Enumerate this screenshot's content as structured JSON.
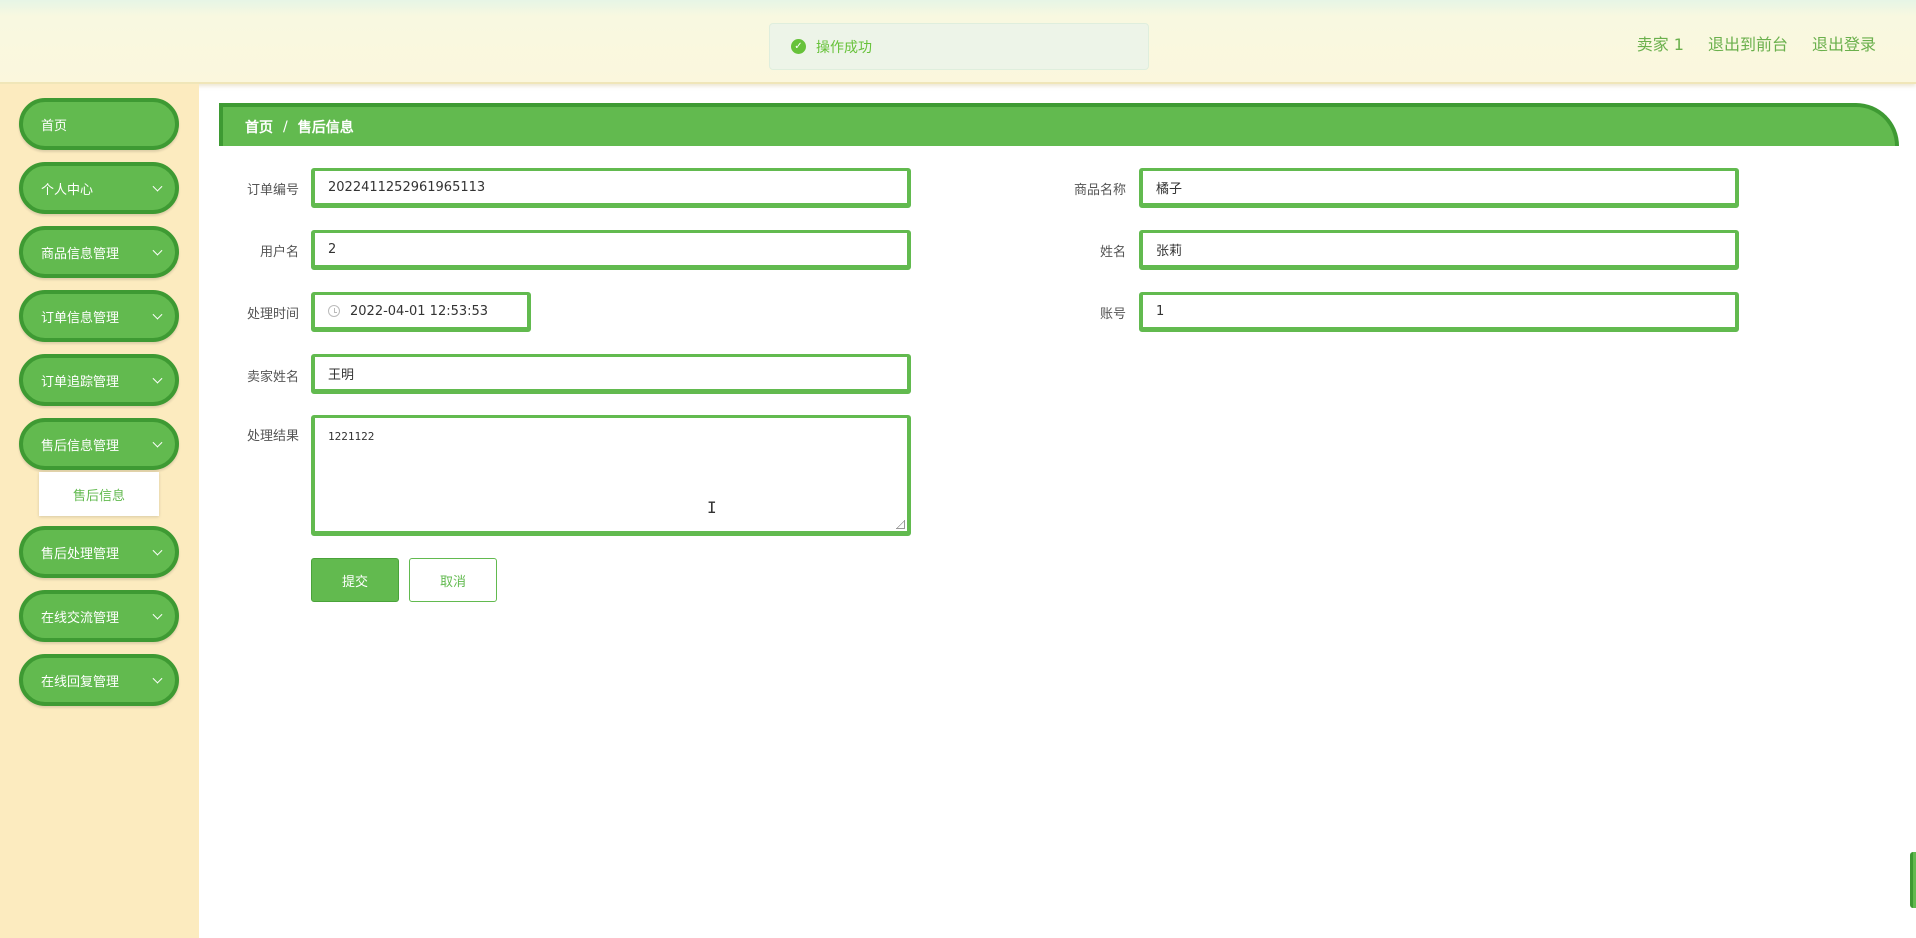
{
  "header": {
    "toast_message": "操作成功",
    "user_label": "卖家 1",
    "back_to_front": "退出到前台",
    "logout": "退出登录"
  },
  "sidebar": {
    "items": [
      {
        "label": "首页",
        "has_submenu": false
      },
      {
        "label": "个人中心",
        "has_submenu": true
      },
      {
        "label": "商品信息管理",
        "has_submenu": true
      },
      {
        "label": "订单信息管理",
        "has_submenu": true
      },
      {
        "label": "订单追踪管理",
        "has_submenu": true
      },
      {
        "label": "售后信息管理",
        "has_submenu": true,
        "expanded": true
      },
      {
        "label": "售后处理管理",
        "has_submenu": true
      },
      {
        "label": "在线交流管理",
        "has_submenu": true
      },
      {
        "label": "在线回复管理",
        "has_submenu": true
      }
    ],
    "active_subitem": "售后信息"
  },
  "breadcrumb": {
    "home": "首页",
    "separator": "/",
    "current": "售后信息"
  },
  "form": {
    "order_no_label": "订单编号",
    "order_no": "2022411252961965113",
    "product_name_label": "商品名称",
    "product_name": "橘子",
    "username_label": "用户名",
    "username": "2",
    "name_label": "姓名",
    "name": "张莉",
    "process_time_label": "处理时间",
    "process_time": "2022-04-01 12:53:53",
    "account_label": "账号",
    "account": "1",
    "seller_name_label": "卖家姓名",
    "seller_name": "王明",
    "result_label": "处理结果",
    "result": "1221122",
    "submit_label": "提交",
    "cancel_label": "取消"
  },
  "colors": {
    "accent": "#62ba4f",
    "accent_dark": "#3e9a33",
    "sidebar_bg": "#fcebbf"
  }
}
